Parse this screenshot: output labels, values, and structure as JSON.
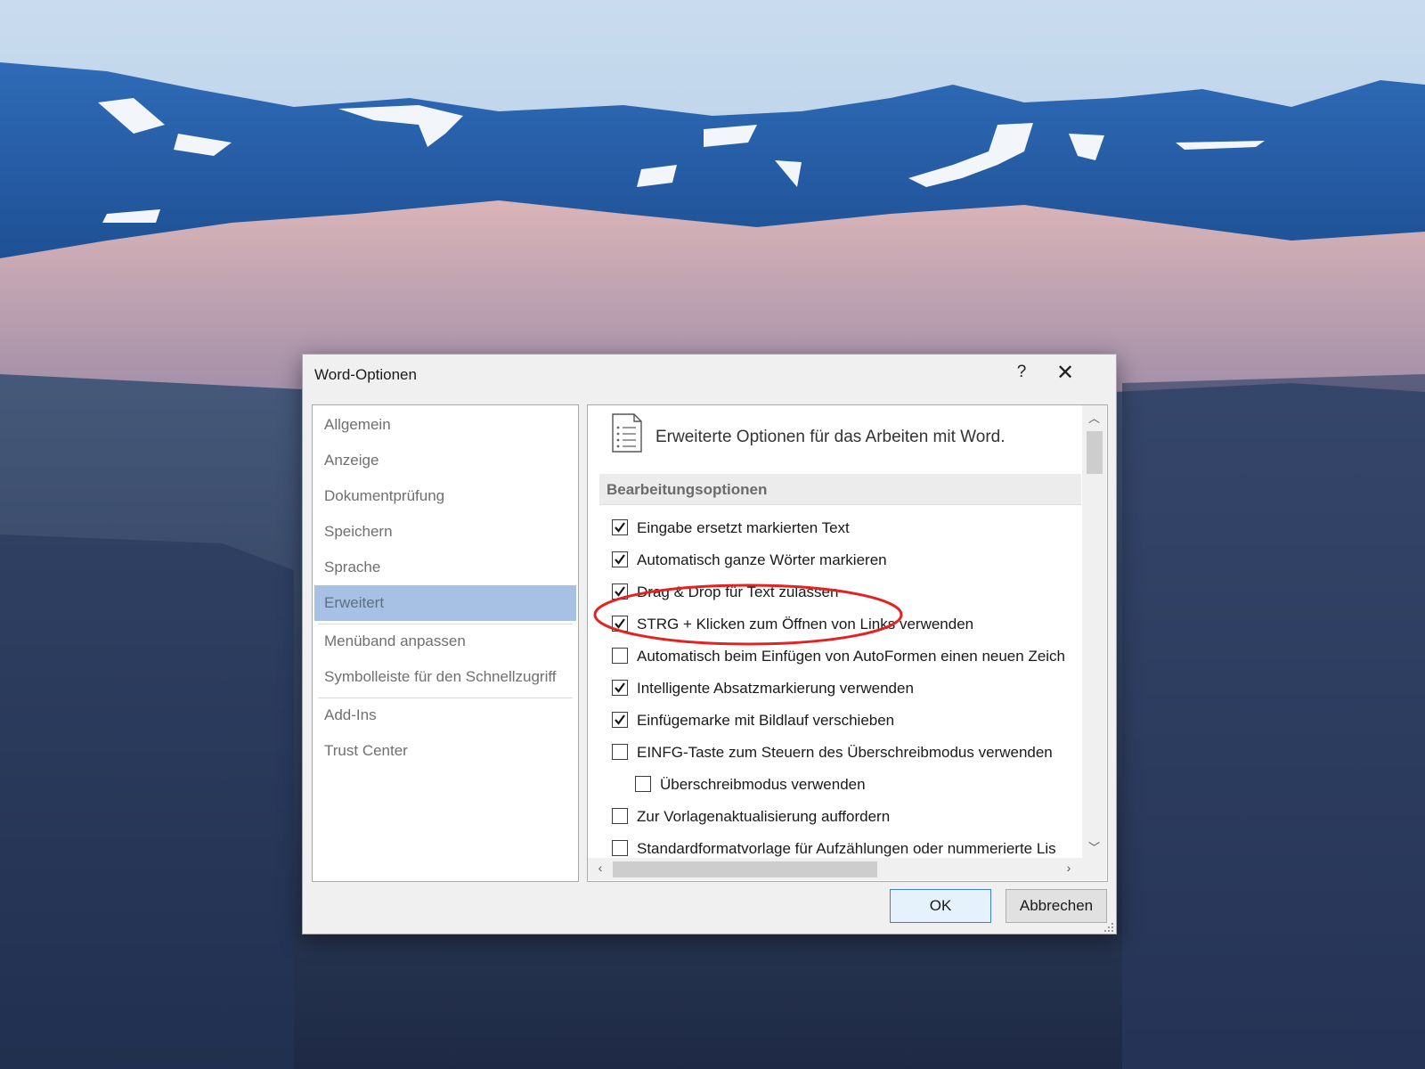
{
  "dialog": {
    "title": "Word-Optionen",
    "help_label": "?",
    "close_label": "✕",
    "ok_label": "OK",
    "cancel_label": "Abbrechen"
  },
  "nav": {
    "items": [
      {
        "label": "Allgemein",
        "selected": false
      },
      {
        "label": "Anzeige",
        "selected": false
      },
      {
        "label": "Dokumentprüfung",
        "selected": false
      },
      {
        "label": "Speichern",
        "selected": false
      },
      {
        "label": "Sprache",
        "selected": false
      },
      {
        "label": "Erweitert",
        "selected": true
      },
      {
        "label": "Menüband anpassen",
        "selected": false
      },
      {
        "label": "Symbolleiste für den Schnellzugriff",
        "selected": false
      },
      {
        "label": "Add-Ins",
        "selected": false
      },
      {
        "label": "Trust Center",
        "selected": false
      }
    ]
  },
  "content": {
    "header": "Erweiterte Optionen für das Arbeiten mit Word.",
    "header_icon": "document-list-icon",
    "section_title": "Bearbeitungsoptionen",
    "options": [
      {
        "label": "Eingabe ersetzt markierten Text",
        "checked": true,
        "indented": false
      },
      {
        "label": "Automatisch ganze Wörter markieren",
        "checked": true,
        "indented": false
      },
      {
        "label": "Drag & Drop für Text zulassen",
        "checked": true,
        "indented": false
      },
      {
        "label": "STRG + Klicken zum Öffnen von Links verwenden",
        "checked": true,
        "indented": false
      },
      {
        "label": "Automatisch beim Einfügen von AutoFormen einen neuen Zeich",
        "checked": false,
        "indented": false
      },
      {
        "label": "Intelligente Absatzmarkierung verwenden",
        "checked": true,
        "indented": false
      },
      {
        "label": "Einfügemarke mit Bildlauf verschieben",
        "checked": true,
        "indented": false
      },
      {
        "label": "EINFG-Taste zum Steuern des Überschreibmodus verwenden",
        "checked": false,
        "indented": false
      },
      {
        "label": "Überschreibmodus verwenden",
        "checked": false,
        "indented": true
      },
      {
        "label": "Zur Vorlagenaktualisierung auffordern",
        "checked": false,
        "indented": false
      },
      {
        "label": "Standardformatvorlage für Aufzählungen oder nummerierte Lis",
        "checked": false,
        "indented": false
      }
    ]
  },
  "colors": {
    "accent_selected": "#a6c1e4",
    "highlight": "#e32222",
    "ok_border": "#3c7fd6"
  }
}
